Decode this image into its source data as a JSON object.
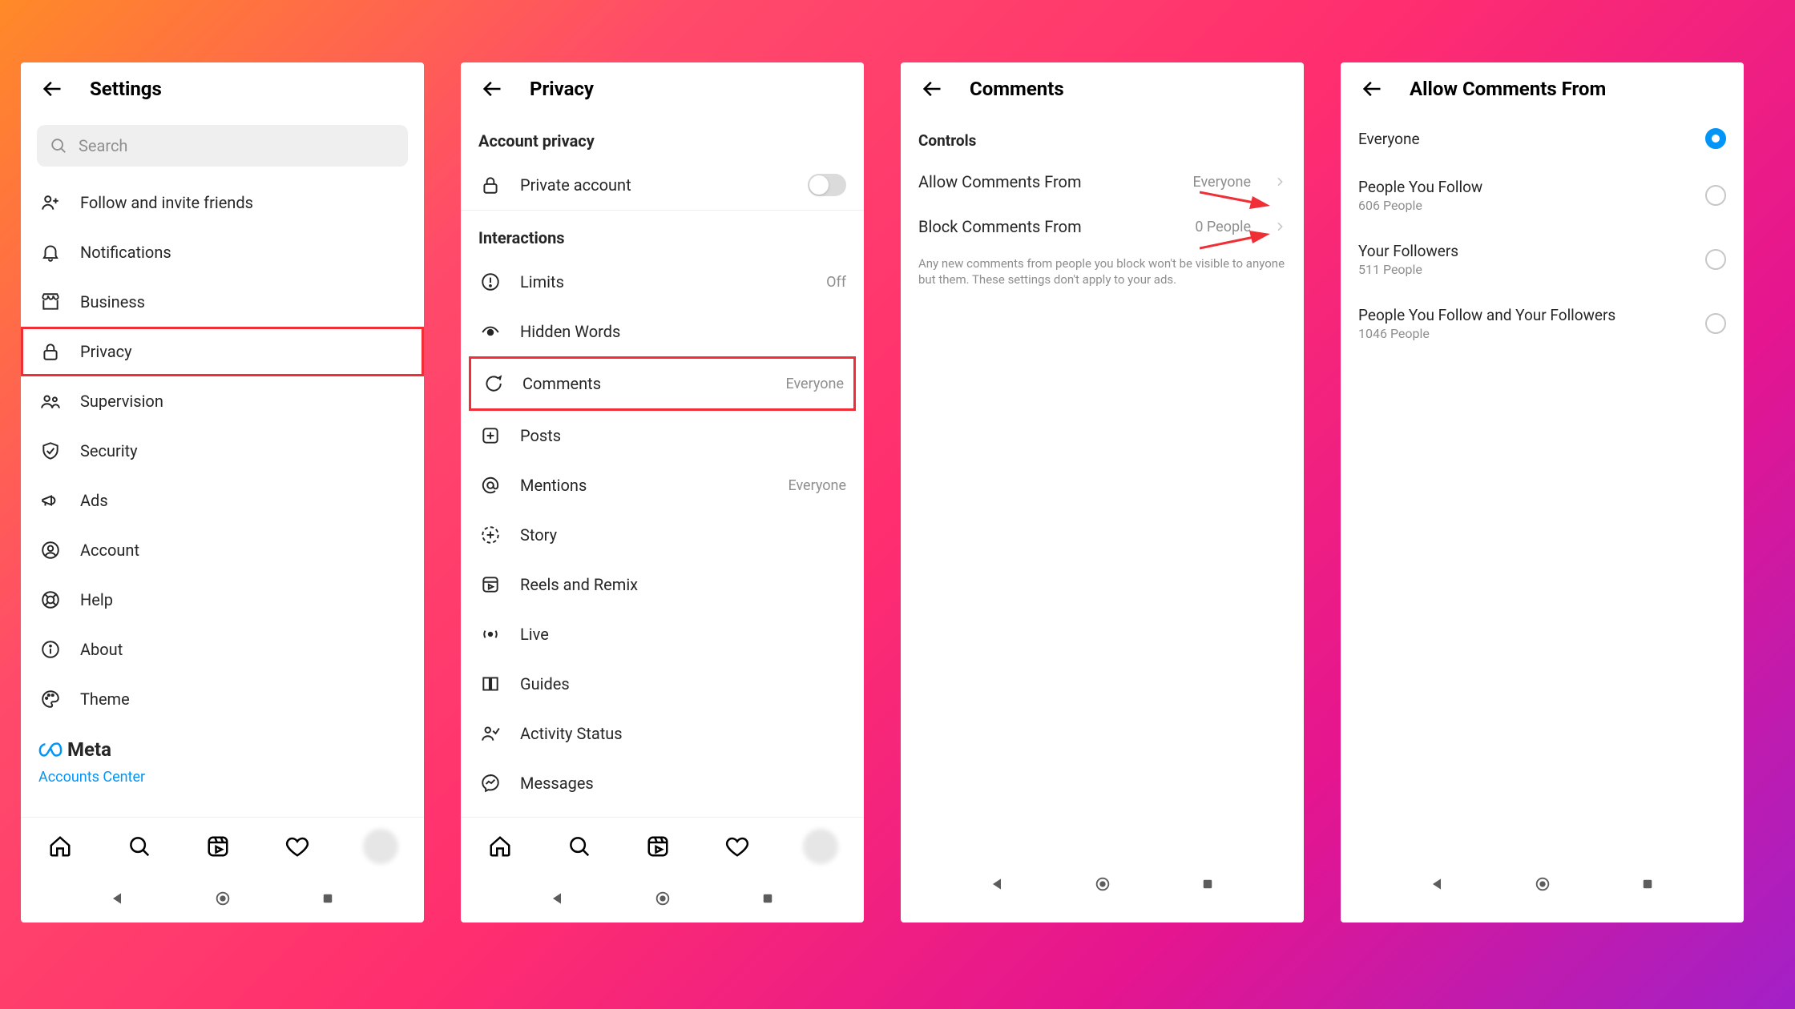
{
  "screens": {
    "settings": {
      "title": "Settings",
      "search_placeholder": "Search",
      "items": [
        {
          "label": "Follow and invite friends"
        },
        {
          "label": "Notifications"
        },
        {
          "label": "Business"
        },
        {
          "label": "Privacy"
        },
        {
          "label": "Supervision"
        },
        {
          "label": "Security"
        },
        {
          "label": "Ads"
        },
        {
          "label": "Account"
        },
        {
          "label": "Help"
        },
        {
          "label": "About"
        },
        {
          "label": "Theme"
        }
      ],
      "meta_brand": "Meta",
      "accounts_center": "Accounts Center"
    },
    "privacy": {
      "title": "Privacy",
      "section_account": "Account privacy",
      "private_account": "Private account",
      "section_interactions": "Interactions",
      "items": [
        {
          "label": "Limits",
          "trail": "Off"
        },
        {
          "label": "Hidden Words",
          "trail": ""
        },
        {
          "label": "Comments",
          "trail": "Everyone"
        },
        {
          "label": "Posts",
          "trail": ""
        },
        {
          "label": "Mentions",
          "trail": "Everyone"
        },
        {
          "label": "Story",
          "trail": ""
        },
        {
          "label": "Reels and Remix",
          "trail": ""
        },
        {
          "label": "Live",
          "trail": ""
        },
        {
          "label": "Guides",
          "trail": ""
        },
        {
          "label": "Activity Status",
          "trail": ""
        },
        {
          "label": "Messages",
          "trail": ""
        }
      ]
    },
    "comments": {
      "title": "Comments",
      "section": "Controls",
      "allow_label": "Allow Comments From",
      "allow_value": "Everyone",
      "block_label": "Block Comments From",
      "block_value": "0 People",
      "helper": "Any new comments from people you block won't be visible to anyone but them. These settings don't apply to your ads."
    },
    "allow": {
      "title": "Allow Comments From",
      "options": [
        {
          "title": "Everyone",
          "sub": "",
          "selected": true
        },
        {
          "title": "People You Follow",
          "sub": "606 People",
          "selected": false
        },
        {
          "title": "Your Followers",
          "sub": "511 People",
          "selected": false
        },
        {
          "title": "People You Follow and Your Followers",
          "sub": "1046 People",
          "selected": false
        }
      ]
    }
  }
}
